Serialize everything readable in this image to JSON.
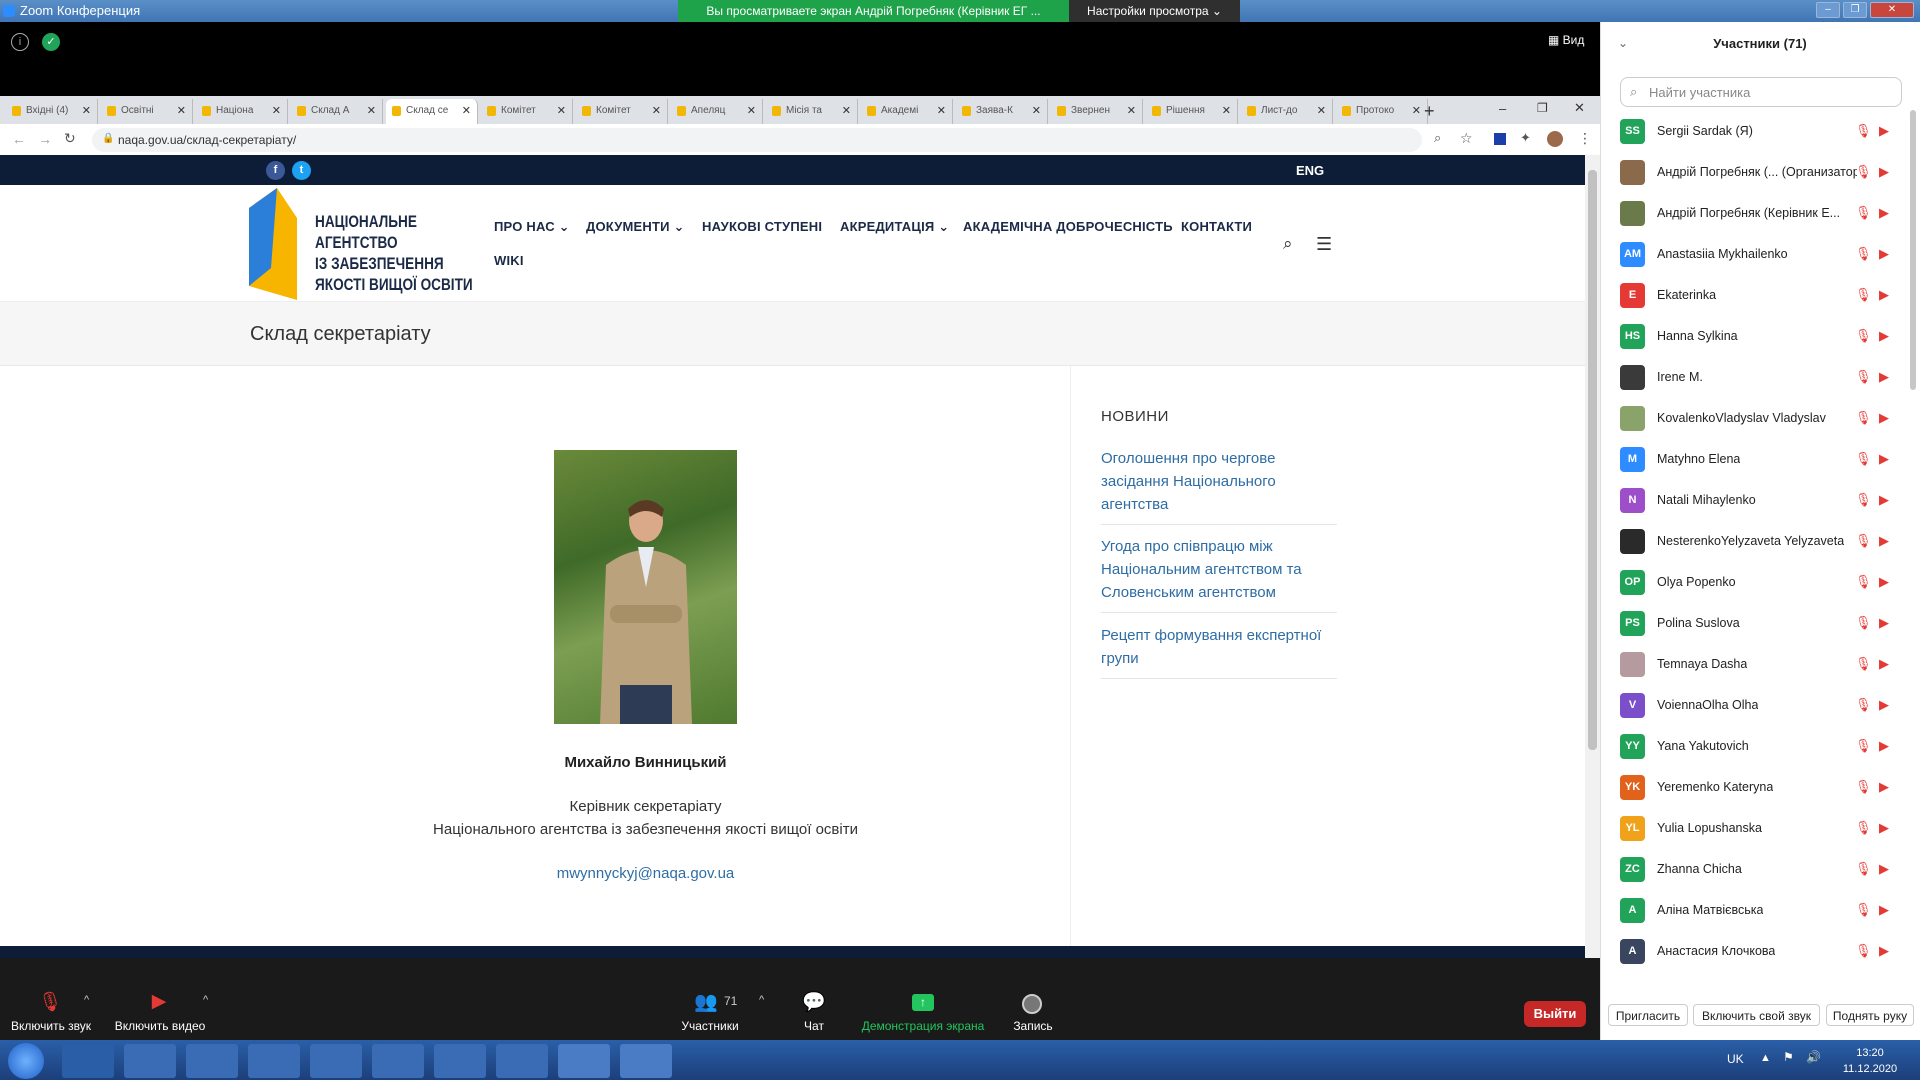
{
  "window": {
    "title": "Zoom Конференция"
  },
  "share_banner": "Вы просматриваете экран Андрій Погребняк (Керівник ЕГ ...",
  "view_options": "Настройки просмотра",
  "zoom_top": {
    "view_label": "Вид"
  },
  "browser": {
    "tabs": [
      {
        "label": "Вхідні (4)"
      },
      {
        "label": "Освітні"
      },
      {
        "label": "Націона"
      },
      {
        "label": "Склад А"
      },
      {
        "label": "Склад се",
        "active": true
      },
      {
        "label": "Комітет"
      },
      {
        "label": "Комітет"
      },
      {
        "label": "Апеляц"
      },
      {
        "label": "Місія та"
      },
      {
        "label": "Академі"
      },
      {
        "label": "Заява-К"
      },
      {
        "label": "Звернен"
      },
      {
        "label": "Рішення"
      },
      {
        "label": "Лист-до"
      },
      {
        "label": "Протоко"
      }
    ],
    "url": "naqa.gov.ua/склад-секретаріату/"
  },
  "site": {
    "lang_switch": "ENG",
    "logo_lines": [
      "Національне",
      "агентство",
      "із забезпечення",
      "якості вищої освіти"
    ],
    "nav": [
      "ПРО НАС",
      "ДОКУМЕНТИ",
      "НАУКОВІ СТУПЕНІ",
      "АКРЕДИТАЦІЯ",
      "АКАДЕМІЧНА ДОБРОЧЕСНІСТЬ",
      "КОНТАКТИ",
      "WIKI"
    ],
    "page_title": "Склад секретаріату",
    "person": {
      "name": "Михайло Винницький",
      "position_line1": "Керівник секретаріату",
      "position_line2": "Національного агентства із забезпечення якості вищої освіти",
      "email": "mwynnyckyj@naqa.gov.ua"
    },
    "news_heading": "НОВИНИ",
    "news": [
      "Оголошення про чергове засідання Національного агентства",
      "Угода про співпрацю між Національним агентством та Словенським агентством",
      "Рецепт формування експертної групи"
    ]
  },
  "zoom_controls": {
    "mute": "Включить звук",
    "video": "Включить видео",
    "participants": "Участники",
    "participants_count": "71",
    "chat": "Чат",
    "share": "Демонстрация экрана",
    "record": "Запись",
    "leave": "Выйти"
  },
  "panel": {
    "title": "Участники (71)",
    "search_placeholder": "Найти участника",
    "participants": [
      {
        "initials": "SS",
        "name": "Sergii Sardak (Я)",
        "color": "#22a35a"
      },
      {
        "initials": "",
        "name": "Андрій Погребняк (... (Организатор)",
        "color": "#8a6a4a"
      },
      {
        "initials": "",
        "name": "Андрій Погребняк (Керівник Е...",
        "color": "#6a7a4a"
      },
      {
        "initials": "AM",
        "name": "Anastasiia Mykhailenko",
        "color": "#2d8cff"
      },
      {
        "initials": "E",
        "name": "Ekaterinka",
        "color": "#e53935"
      },
      {
        "initials": "HS",
        "name": "Hanna Sylkina",
        "color": "#22a35a"
      },
      {
        "initials": "",
        "name": "Irene M.",
        "color": "#3a3a3a"
      },
      {
        "initials": "",
        "name": "KovalenkoVladyslav Vladyslav",
        "color": "#8aa36a"
      },
      {
        "initials": "M",
        "name": "Matyhno Elena",
        "color": "#2d8cff"
      },
      {
        "initials": "N",
        "name": "Natali Mihaylenko",
        "color": "#9c4fc9"
      },
      {
        "initials": "",
        "name": "NesterenkoYelyzaveta Yelyzaveta",
        "color": "#2a2a2a"
      },
      {
        "initials": "OP",
        "name": "Olya Popenko",
        "color": "#22a35a"
      },
      {
        "initials": "PS",
        "name": "Polina Suslova",
        "color": "#22a35a"
      },
      {
        "initials": "",
        "name": "Temnaya Dasha",
        "color": "#b59aa0"
      },
      {
        "initials": "V",
        "name": "VoiennaOlha Olha",
        "color": "#7b4fc9"
      },
      {
        "initials": "YY",
        "name": "Yana Yakutovich",
        "color": "#22a35a"
      },
      {
        "initials": "YK",
        "name": "Yeremenko Kateryna",
        "color": "#e0621b"
      },
      {
        "initials": "YL",
        "name": "Yulia Lopushanska",
        "color": "#f0a21b"
      },
      {
        "initials": "ZC",
        "name": "Zhanna Chicha",
        "color": "#22a35a"
      },
      {
        "initials": "A",
        "name": "Аліна Матвієвська",
        "color": "#22a35a"
      },
      {
        "initials": "A",
        "name": "Анастасия Клочкова",
        "color": "#3a4660"
      }
    ],
    "invite": "Пригласить",
    "unmute_me": "Включить свой звук",
    "raise_hand": "Поднять руку"
  },
  "taskbar": {
    "lang": "UK",
    "time": "13:20",
    "date": "11.12.2020"
  }
}
